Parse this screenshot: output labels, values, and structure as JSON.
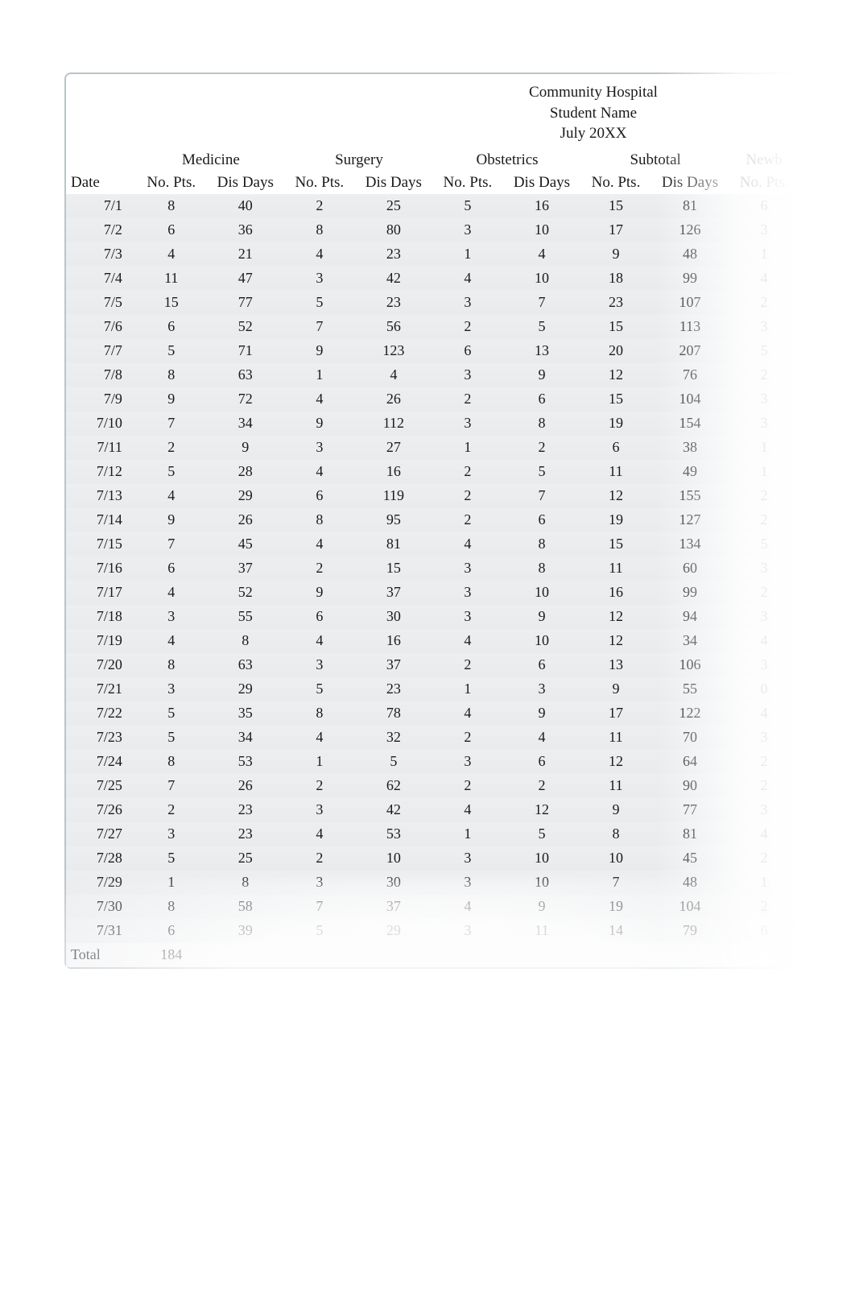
{
  "header": {
    "hospital": "Community Hospital",
    "student": "Student Name",
    "period": "July 20XX"
  },
  "groups": [
    "Medicine",
    "Surgery",
    "Obstetrics",
    "Subtotal",
    "Newb"
  ],
  "subheaders": {
    "date": "Date",
    "no_pts": "No. Pts.",
    "dis_days": "Dis Days"
  },
  "rows": [
    {
      "date": "7/1",
      "med_pts": 8,
      "med_days": 40,
      "sur_pts": 2,
      "sur_days": 25,
      "ob_pts": 5,
      "ob_days": 16,
      "sub_pts": 15,
      "sub_days": 81,
      "newb_pts": 6
    },
    {
      "date": "7/2",
      "med_pts": 6,
      "med_days": 36,
      "sur_pts": 8,
      "sur_days": 80,
      "ob_pts": 3,
      "ob_days": 10,
      "sub_pts": 17,
      "sub_days": 126,
      "newb_pts": 3
    },
    {
      "date": "7/3",
      "med_pts": 4,
      "med_days": 21,
      "sur_pts": 4,
      "sur_days": 23,
      "ob_pts": 1,
      "ob_days": 4,
      "sub_pts": 9,
      "sub_days": 48,
      "newb_pts": 1
    },
    {
      "date": "7/4",
      "med_pts": 11,
      "med_days": 47,
      "sur_pts": 3,
      "sur_days": 42,
      "ob_pts": 4,
      "ob_days": 10,
      "sub_pts": 18,
      "sub_days": 99,
      "newb_pts": 4
    },
    {
      "date": "7/5",
      "med_pts": 15,
      "med_days": 77,
      "sur_pts": 5,
      "sur_days": 23,
      "ob_pts": 3,
      "ob_days": 7,
      "sub_pts": 23,
      "sub_days": 107,
      "newb_pts": 2
    },
    {
      "date": "7/6",
      "med_pts": 6,
      "med_days": 52,
      "sur_pts": 7,
      "sur_days": 56,
      "ob_pts": 2,
      "ob_days": 5,
      "sub_pts": 15,
      "sub_days": 113,
      "newb_pts": 3
    },
    {
      "date": "7/7",
      "med_pts": 5,
      "med_days": 71,
      "sur_pts": 9,
      "sur_days": 123,
      "ob_pts": 6,
      "ob_days": 13,
      "sub_pts": 20,
      "sub_days": 207,
      "newb_pts": 5
    },
    {
      "date": "7/8",
      "med_pts": 8,
      "med_days": 63,
      "sur_pts": 1,
      "sur_days": 4,
      "ob_pts": 3,
      "ob_days": 9,
      "sub_pts": 12,
      "sub_days": 76,
      "newb_pts": 2
    },
    {
      "date": "7/9",
      "med_pts": 9,
      "med_days": 72,
      "sur_pts": 4,
      "sur_days": 26,
      "ob_pts": 2,
      "ob_days": 6,
      "sub_pts": 15,
      "sub_days": 104,
      "newb_pts": 3
    },
    {
      "date": "7/10",
      "med_pts": 7,
      "med_days": 34,
      "sur_pts": 9,
      "sur_days": 112,
      "ob_pts": 3,
      "ob_days": 8,
      "sub_pts": 19,
      "sub_days": 154,
      "newb_pts": 3
    },
    {
      "date": "7/11",
      "med_pts": 2,
      "med_days": 9,
      "sur_pts": 3,
      "sur_days": 27,
      "ob_pts": 1,
      "ob_days": 2,
      "sub_pts": 6,
      "sub_days": 38,
      "newb_pts": 1
    },
    {
      "date": "7/12",
      "med_pts": 5,
      "med_days": 28,
      "sur_pts": 4,
      "sur_days": 16,
      "ob_pts": 2,
      "ob_days": 5,
      "sub_pts": 11,
      "sub_days": 49,
      "newb_pts": 1
    },
    {
      "date": "7/13",
      "med_pts": 4,
      "med_days": 29,
      "sur_pts": 6,
      "sur_days": 119,
      "ob_pts": 2,
      "ob_days": 7,
      "sub_pts": 12,
      "sub_days": 155,
      "newb_pts": 2
    },
    {
      "date": "7/14",
      "med_pts": 9,
      "med_days": 26,
      "sur_pts": 8,
      "sur_days": 95,
      "ob_pts": 2,
      "ob_days": 6,
      "sub_pts": 19,
      "sub_days": 127,
      "newb_pts": 2
    },
    {
      "date": "7/15",
      "med_pts": 7,
      "med_days": 45,
      "sur_pts": 4,
      "sur_days": 81,
      "ob_pts": 4,
      "ob_days": 8,
      "sub_pts": 15,
      "sub_days": 134,
      "newb_pts": 5
    },
    {
      "date": "7/16",
      "med_pts": 6,
      "med_days": 37,
      "sur_pts": 2,
      "sur_days": 15,
      "ob_pts": 3,
      "ob_days": 8,
      "sub_pts": 11,
      "sub_days": 60,
      "newb_pts": 3
    },
    {
      "date": "7/17",
      "med_pts": 4,
      "med_days": 52,
      "sur_pts": 9,
      "sur_days": 37,
      "ob_pts": 3,
      "ob_days": 10,
      "sub_pts": 16,
      "sub_days": 99,
      "newb_pts": 2
    },
    {
      "date": "7/18",
      "med_pts": 3,
      "med_days": 55,
      "sur_pts": 6,
      "sur_days": 30,
      "ob_pts": 3,
      "ob_days": 9,
      "sub_pts": 12,
      "sub_days": 94,
      "newb_pts": 3
    },
    {
      "date": "7/19",
      "med_pts": 4,
      "med_days": 8,
      "sur_pts": 4,
      "sur_days": 16,
      "ob_pts": 4,
      "ob_days": 10,
      "sub_pts": 12,
      "sub_days": 34,
      "newb_pts": 4
    },
    {
      "date": "7/20",
      "med_pts": 8,
      "med_days": 63,
      "sur_pts": 3,
      "sur_days": 37,
      "ob_pts": 2,
      "ob_days": 6,
      "sub_pts": 13,
      "sub_days": 106,
      "newb_pts": 3
    },
    {
      "date": "7/21",
      "med_pts": 3,
      "med_days": 29,
      "sur_pts": 5,
      "sur_days": 23,
      "ob_pts": 1,
      "ob_days": 3,
      "sub_pts": 9,
      "sub_days": 55,
      "newb_pts": 0
    },
    {
      "date": "7/22",
      "med_pts": 5,
      "med_days": 35,
      "sur_pts": 8,
      "sur_days": 78,
      "ob_pts": 4,
      "ob_days": 9,
      "sub_pts": 17,
      "sub_days": 122,
      "newb_pts": 4
    },
    {
      "date": "7/23",
      "med_pts": 5,
      "med_days": 34,
      "sur_pts": 4,
      "sur_days": 32,
      "ob_pts": 2,
      "ob_days": 4,
      "sub_pts": 11,
      "sub_days": 70,
      "newb_pts": 3
    },
    {
      "date": "7/24",
      "med_pts": 8,
      "med_days": 53,
      "sur_pts": 1,
      "sur_days": 5,
      "ob_pts": 3,
      "ob_days": 6,
      "sub_pts": 12,
      "sub_days": 64,
      "newb_pts": 2
    },
    {
      "date": "7/25",
      "med_pts": 7,
      "med_days": 26,
      "sur_pts": 2,
      "sur_days": 62,
      "ob_pts": 2,
      "ob_days": 2,
      "sub_pts": 11,
      "sub_days": 90,
      "newb_pts": 2
    },
    {
      "date": "7/26",
      "med_pts": 2,
      "med_days": 23,
      "sur_pts": 3,
      "sur_days": 42,
      "ob_pts": 4,
      "ob_days": 12,
      "sub_pts": 9,
      "sub_days": 77,
      "newb_pts": 3
    },
    {
      "date": "7/27",
      "med_pts": 3,
      "med_days": 23,
      "sur_pts": 4,
      "sur_days": 53,
      "ob_pts": 1,
      "ob_days": 5,
      "sub_pts": 8,
      "sub_days": 81,
      "newb_pts": 4
    },
    {
      "date": "7/28",
      "med_pts": 5,
      "med_days": 25,
      "sur_pts": 2,
      "sur_days": 10,
      "ob_pts": 3,
      "ob_days": 10,
      "sub_pts": 10,
      "sub_days": 45,
      "newb_pts": 2
    },
    {
      "date": "7/29",
      "med_pts": 1,
      "med_days": 8,
      "sur_pts": 3,
      "sur_days": 30,
      "ob_pts": 3,
      "ob_days": 10,
      "sub_pts": 7,
      "sub_days": 48,
      "newb_pts": 1
    },
    {
      "date": "7/30",
      "med_pts": 8,
      "med_days": 58,
      "sur_pts": 7,
      "sur_days": 37,
      "ob_pts": 4,
      "ob_days": 9,
      "sub_pts": 19,
      "sub_days": 104,
      "newb_pts": 2
    },
    {
      "date": "7/31",
      "med_pts": 6,
      "med_days": 39,
      "sur_pts": 5,
      "sur_days": 29,
      "ob_pts": 3,
      "ob_days": 11,
      "sub_pts": 14,
      "sub_days": 79,
      "newb_pts": 6
    }
  ],
  "total": {
    "label": "Total",
    "med_pts": 184
  }
}
